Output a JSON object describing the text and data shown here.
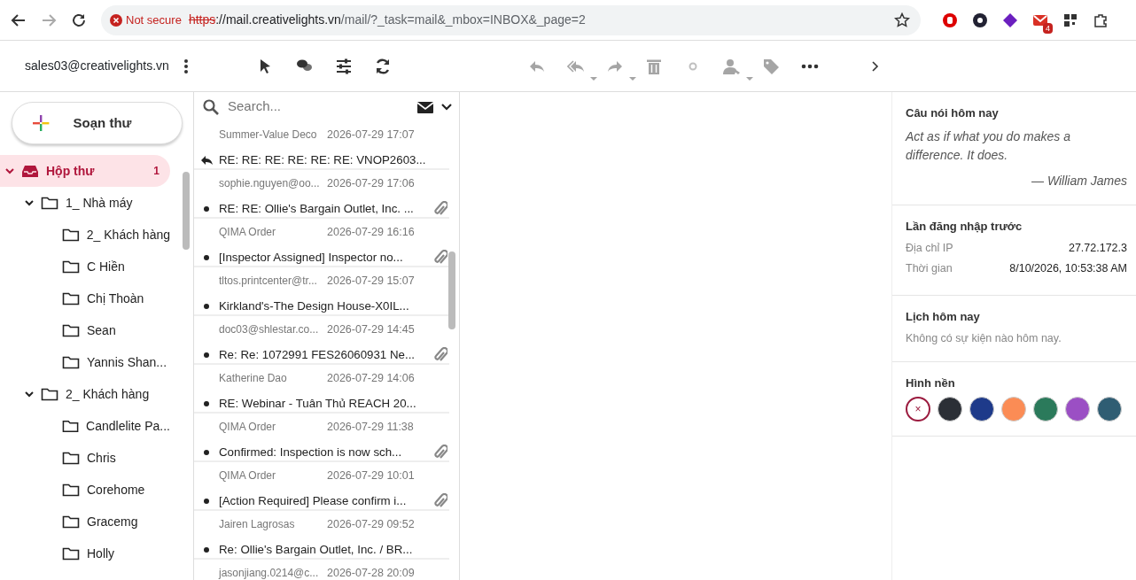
{
  "browser": {
    "not_secure": "Not secure",
    "url_parts": [
      "https",
      "://mail.creativelights.vn",
      "/mail/?_task=mail&_mbox=INBOX&_page=2"
    ],
    "extension_badge": "4"
  },
  "header": {
    "account": "sales03@creativelights.vn"
  },
  "toolbar": [
    {
      "kind": "select",
      "disabled": false,
      "dropdown": false
    },
    {
      "kind": "threads",
      "disabled": false,
      "dropdown": false
    },
    {
      "kind": "options",
      "disabled": false,
      "dropdown": false
    },
    {
      "kind": "refresh",
      "disabled": false,
      "dropdown": false
    },
    {
      "kind": "reply",
      "disabled": true,
      "dropdown": false
    },
    {
      "kind": "reply-all",
      "disabled": true,
      "dropdown": true
    },
    {
      "kind": "forward",
      "disabled": true,
      "dropdown": true
    },
    {
      "kind": "delete",
      "disabled": true,
      "dropdown": false
    },
    {
      "kind": "dot",
      "disabled": true,
      "dropdown": false
    },
    {
      "kind": "contact",
      "disabled": true,
      "dropdown": true
    },
    {
      "kind": "tag",
      "disabled": true,
      "dropdown": false
    },
    {
      "kind": "more",
      "disabled": false,
      "dropdown": false
    },
    {
      "kind": "next",
      "disabled": false,
      "dropdown": false
    }
  ],
  "compose": {
    "label": "Soạn thư"
  },
  "folders": [
    {
      "name": "Hộp thư",
      "kind": "inbox",
      "count": "1",
      "selected": true,
      "expanded": true,
      "children": [
        {
          "name": "1_ Nhà máy",
          "kind": "folder",
          "selected": false,
          "expanded": true,
          "children": [
            {
              "name": "2_ Khách hàng",
              "kind": "folder",
              "selected": false
            },
            {
              "name": "C Hiền",
              "kind": "folder",
              "selected": false
            },
            {
              "name": "Chị Thoàn",
              "kind": "folder",
              "selected": false
            },
            {
              "name": "Sean",
              "kind": "folder",
              "selected": false
            },
            {
              "name": "Yannis Shan...",
              "kind": "folder",
              "selected": false
            }
          ]
        },
        {
          "name": "2_ Khách hàng",
          "kind": "folder",
          "selected": false,
          "expanded": true,
          "children": [
            {
              "name": "Candlelite Pa...",
              "kind": "folder",
              "selected": false
            },
            {
              "name": "Chris",
              "kind": "folder",
              "selected": false
            },
            {
              "name": "Corehome",
              "kind": "folder",
              "selected": false
            },
            {
              "name": "Gracemg",
              "kind": "folder",
              "selected": false
            },
            {
              "name": "Holly",
              "kind": "folder",
              "selected": false
            }
          ]
        }
      ]
    }
  ],
  "search": {
    "placeholder": "Search..."
  },
  "messages": [
    {
      "sender": "Summer-Value Deco",
      "date": "2026-07-29 17:07",
      "subject": "RE: RE: RE: RE: RE: RE: VNOP2603...",
      "replied": true,
      "unread": false,
      "attachment": false
    },
    {
      "sender": "sophie.nguyen@oo...",
      "date": "2026-07-29 17:06",
      "subject": "RE: RE: Ollie's Bargain Outlet, Inc. ...",
      "replied": false,
      "unread": true,
      "attachment": true
    },
    {
      "sender": "QIMA Order",
      "date": "2026-07-29 16:16",
      "subject": "[Inspector Assigned] Inspector no...",
      "replied": false,
      "unread": true,
      "attachment": true
    },
    {
      "sender": "tltos.printcenter@tr...",
      "date": "2026-07-29 15:07",
      "subject": "Kirkland's-The Design House-X0IL...",
      "replied": false,
      "unread": true,
      "attachment": false
    },
    {
      "sender": "doc03@shlestar.co...",
      "date": "2026-07-29 14:45",
      "subject": "Re: Re: 1072991 FES26060931 Ne...",
      "replied": false,
      "unread": true,
      "attachment": true
    },
    {
      "sender": "Katherine Dao",
      "date": "2026-07-29 14:06",
      "subject": "RE: Webinar - Tuân Thủ REACH 20...",
      "replied": false,
      "unread": true,
      "attachment": false
    },
    {
      "sender": "QIMA Order",
      "date": "2026-07-29 11:38",
      "subject": "Confirmed: Inspection is now sch...",
      "replied": false,
      "unread": true,
      "attachment": true
    },
    {
      "sender": "QIMA Order",
      "date": "2026-07-29 10:01",
      "subject": "[Action Required] Please confirm i...",
      "replied": false,
      "unread": true,
      "attachment": true
    },
    {
      "sender": "Jairen Lagrosas",
      "date": "2026-07-29 09:52",
      "subject": "Re: Ollie's Bargain Outlet, Inc. / BR...",
      "replied": false,
      "unread": true,
      "attachment": false
    },
    {
      "sender": "jasonjiang.0214@c...",
      "date": "2026-07-28 20:09"
    }
  ],
  "quote": {
    "title": "Câu nói hôm nay",
    "text": "Act as if what you do makes a difference. It does.",
    "author": "— William James"
  },
  "last_login": {
    "title": "Lần đăng nhập trước",
    "rows": [
      {
        "label": "Địa chỉ IP",
        "value": "27.72.172.3"
      },
      {
        "label": "Thời gian",
        "value": "8/10/2026, 10:53:38 AM"
      }
    ]
  },
  "calendar": {
    "title": "Lịch hôm nay",
    "empty": "Không có sự kiện nào hôm nay."
  },
  "wallpaper": {
    "title": "Hình nền",
    "none_mark": "×",
    "swatches": [
      {
        "kind": "none",
        "selected": true
      },
      {
        "kind": "color",
        "color": "#2b2f36",
        "selected": false
      },
      {
        "kind": "color",
        "color": "#1e3a8a",
        "selected": false
      },
      {
        "kind": "color",
        "color": "#fb8c55",
        "selected": false
      },
      {
        "kind": "color",
        "color": "#2b7a5b",
        "selected": false
      },
      {
        "kind": "color",
        "color": "#9b4fc4",
        "selected": false
      },
      {
        "kind": "color",
        "color": "#2f5d73",
        "selected": false
      }
    ]
  }
}
